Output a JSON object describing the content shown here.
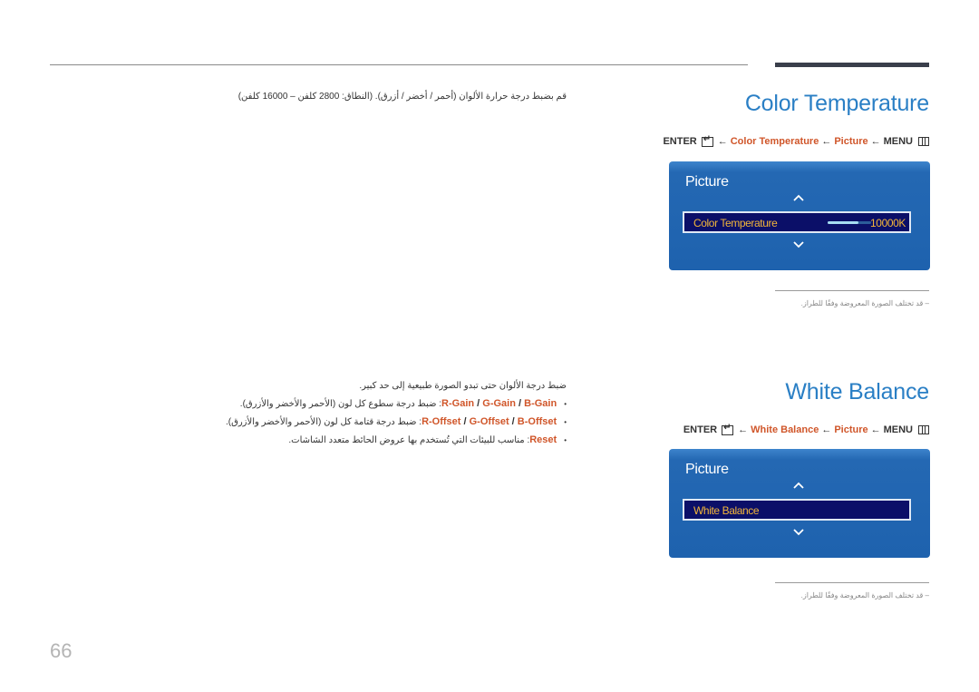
{
  "colors": {
    "title_blue": "#2a7fc5",
    "highlight_orange": "#d0562a",
    "osd_blue": "#1e62ae",
    "osd_item_bg": "#0b0f68",
    "osd_item_text": "#f2b53a"
  },
  "sections": [
    {
      "title": "Color Temperature",
      "breadcrumb": {
        "enter": "ENTER",
        "arrow": "←",
        "item": "Color Temperature",
        "menu_group": "Picture",
        "menu": "MENU"
      },
      "osd": {
        "title": "Picture",
        "item_label": "Color Temperature",
        "value": "10000K",
        "slider_fraction": 0.7
      },
      "note": "– قد تختلف الصورة المعروضة وفقًا للطراز.",
      "description": "قم بضبط درجة حرارة الألوان (أحمر / أخضر / أزرق). (النطاق: 2800 كلفن – 16000 كلفن)"
    },
    {
      "title": "White Balance",
      "breadcrumb": {
        "enter": "ENTER",
        "arrow": "←",
        "item": "White Balance",
        "menu_group": "Picture",
        "menu": "MENU"
      },
      "osd": {
        "title": "Picture",
        "item_label": "White Balance"
      },
      "note": "– قد تختلف الصورة المعروضة وفقًا للطراز.",
      "description": "ضبط درجة الألوان حتى تبدو الصورة طبيعية إلى حد كبير.",
      "bullets": [
        {
          "terms": [
            "B-Gain",
            "G-Gain",
            "R-Gain"
          ],
          "text": ": ضبط درجة سطوع كل لون (الأحمر والأخضر والأزرق)."
        },
        {
          "terms": [
            "B-Offset",
            "G-Offset",
            "R-Offset"
          ],
          "text": ": ضبط درجة قتامة كل لون (الأحمر والأخضر والأزرق)."
        },
        {
          "terms": [
            "Reset"
          ],
          "text": ": مناسب للبيئات التي تُستخدم بها عروض الحائط متعدد الشاشات."
        }
      ]
    }
  ],
  "page_number": "66"
}
